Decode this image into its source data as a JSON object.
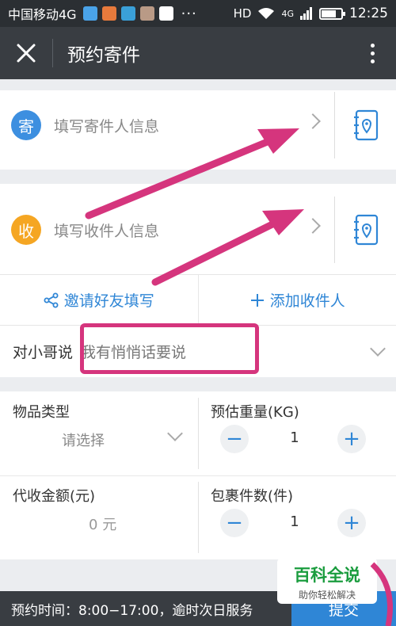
{
  "status_bar": {
    "carrier": "中国移动4G",
    "net": "HD",
    "sig": "4G",
    "time": "12:25",
    "dots": "···"
  },
  "title_bar": {
    "title": "预约寄件"
  },
  "sender": {
    "badge": "寄",
    "label": "填写寄件人信息",
    "color": "#3d8fe0"
  },
  "receiver": {
    "badge": "收",
    "label": "填写收件人信息",
    "color": "#f5a623"
  },
  "actions": {
    "invite": "邀请好友填写",
    "add": "添加收件人"
  },
  "note": {
    "label": "对小哥说",
    "placeholder": "我有悄悄话要说"
  },
  "item_type": {
    "label": "物品类型",
    "value": "请选择"
  },
  "weight": {
    "label": "预估重量(KG)",
    "value": "1"
  },
  "cod": {
    "label": "代收金额(元)",
    "value": "0",
    "unit": "元"
  },
  "parcels": {
    "label": "包裹件数(件)",
    "value": "1"
  },
  "footer": {
    "text": "预约时间：8:00−17:00，逾时次日服务",
    "submit": "提交"
  },
  "watermark": {
    "main": "百科全说",
    "sub": "助你轻松解决"
  },
  "colors": {
    "accent": "#2f86d6",
    "highlight": "#d5357d",
    "titlebar": "#393d42"
  }
}
